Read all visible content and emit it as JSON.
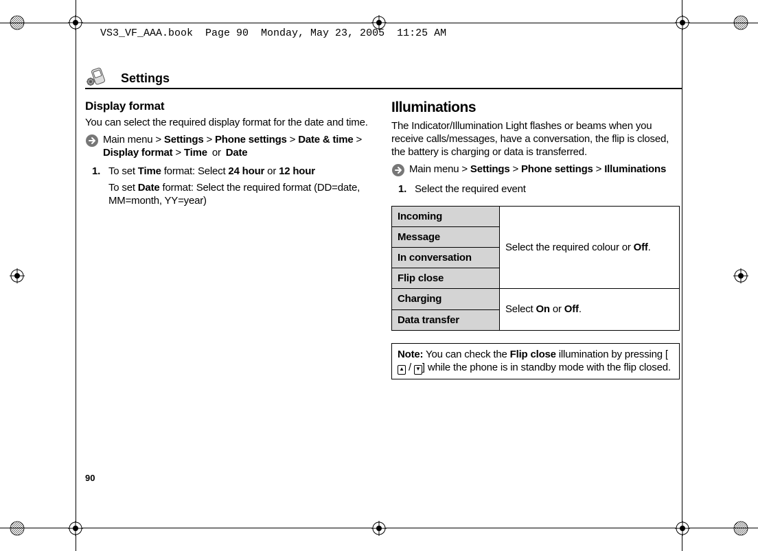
{
  "header_info": "VS3_VF_AAA.book  Page 90  Monday, May 23, 2005  11:25 AM",
  "page_number": "90",
  "section_title": "Settings",
  "left": {
    "heading": "Display format",
    "intro": "You can select the required display format for the date and time.",
    "nav": {
      "prefix": "Main menu",
      "path": [
        "Settings",
        "Phone settings",
        "Date & time",
        "Display format"
      ],
      "tail_a": "Time",
      "or": "or",
      "tail_b": "Date"
    },
    "step1": {
      "num": "1.",
      "line1_pre": "To set ",
      "line1_b1": "Time",
      "line1_mid": " format: Select ",
      "line1_b2": "24 hour",
      "line1_or": " or ",
      "line1_b3": "12 hour",
      "line2_pre": "To set ",
      "line2_b1": "Date",
      "line2_post": " format: Select the required format (DD=date, MM=month, YY=year)"
    }
  },
  "right": {
    "heading": "Illuminations",
    "intro": "The Indicator/Illumination Light flashes or beams when you receive calls/messages, have a conversation, the flip is closed, the battery is charging or data is transferred.",
    "nav": {
      "prefix": "Main menu",
      "path": [
        "Settings",
        "Phone settings",
        "Illuminations"
      ]
    },
    "step1": {
      "num": "1.",
      "text": "Select the required event"
    },
    "table": {
      "rows_a": [
        "Incoming",
        "Message",
        "In conversation",
        "Flip close"
      ],
      "rows_b": [
        "Charging",
        "Data transfer"
      ],
      "cell_a_pre": "Select the required colour or ",
      "cell_a_b": "Off",
      "cell_a_post": ".",
      "cell_b_pre": "Select ",
      "cell_b_b1": "On",
      "cell_b_mid": " or ",
      "cell_b_b2": "Off",
      "cell_b_post": "."
    },
    "note": {
      "label": "Note:",
      "pre": "  You can check the ",
      "b": "Flip close",
      "mid": " illumination by pressing [",
      "key_sep": " / ",
      "post": "] while the phone is in standby mode with the flip closed."
    }
  }
}
